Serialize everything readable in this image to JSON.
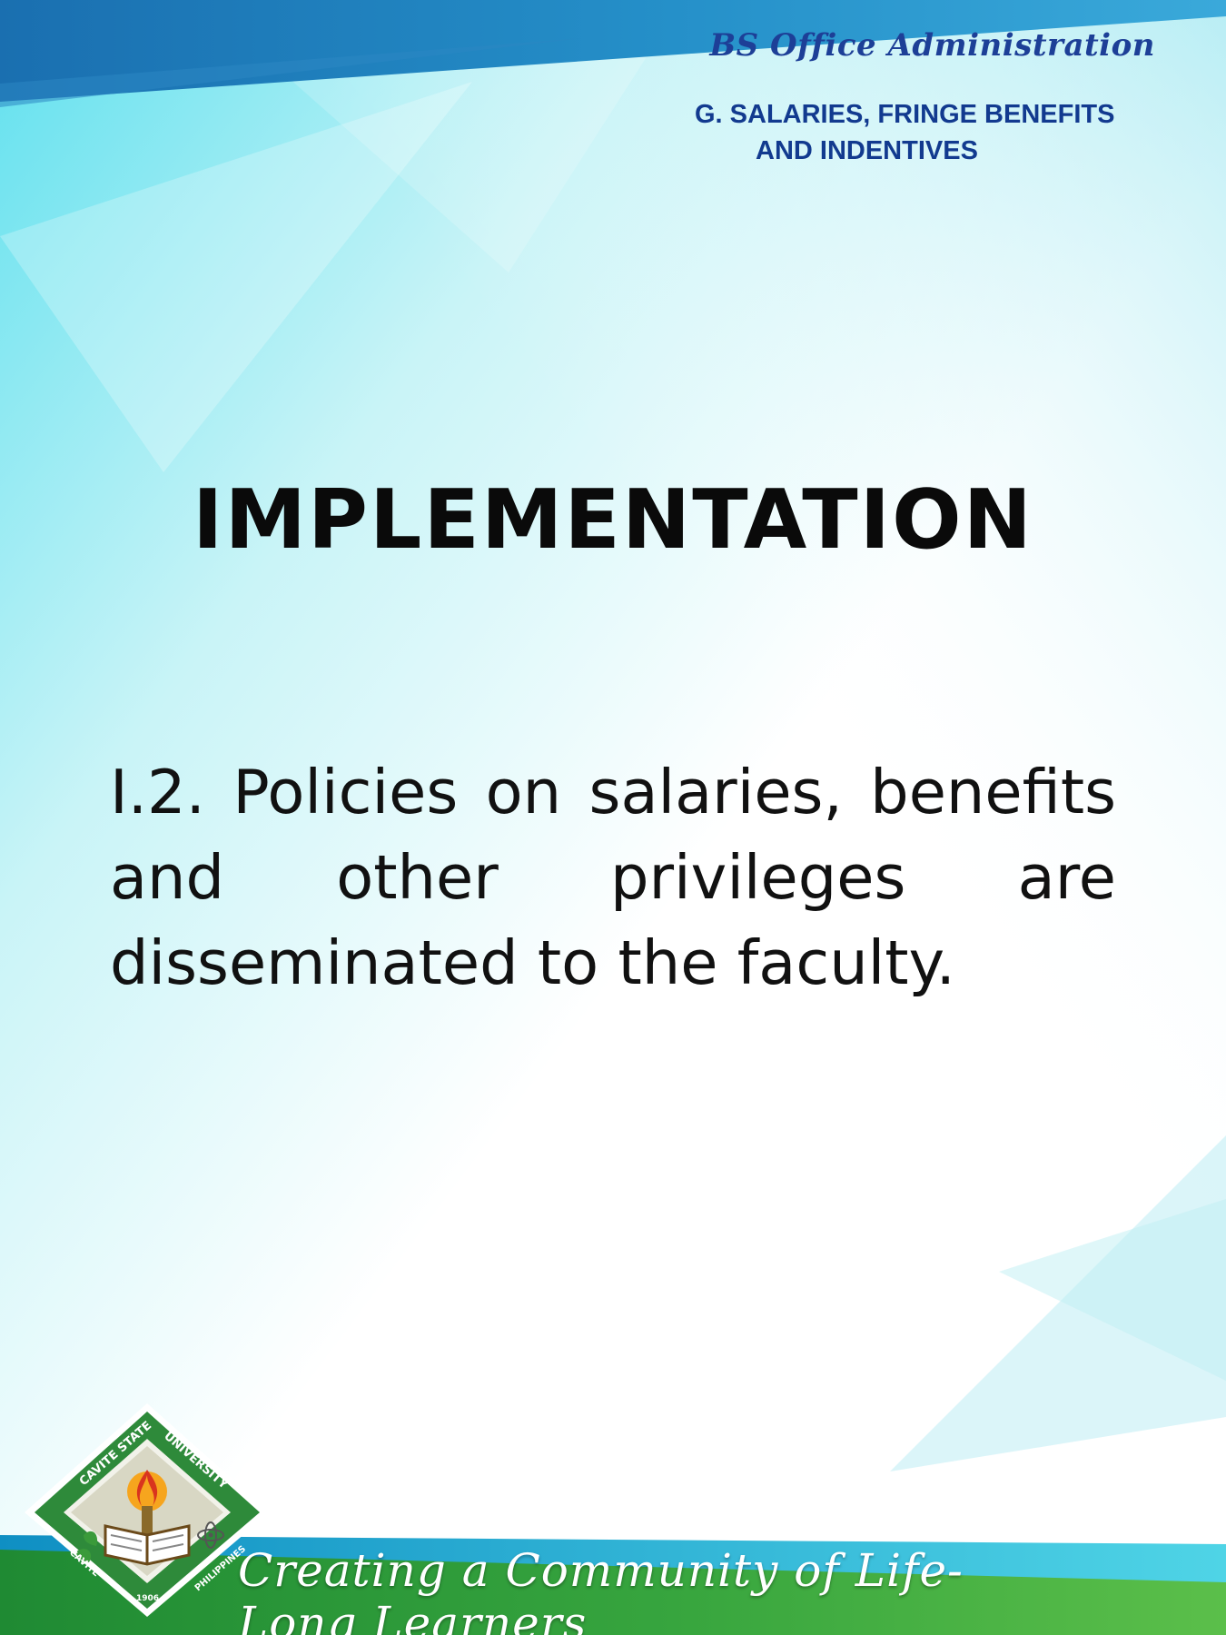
{
  "header": {
    "program_name": "BS Office Administration",
    "section_line1": "G. SALARIES, FRINGE BENEFITS",
    "section_line2": "AND INDENTIVES"
  },
  "main": {
    "title": "IMPLEMENTATION",
    "body": "I.2. Policies on salaries, benefits and other privileges are disseminated to the faculty."
  },
  "footer": {
    "tagline": "Creating a Community of Life-Long Learners",
    "logo_top_text": "CAVITE STATE UNIVERSITY",
    "logo_bottom_left": "CAVITE",
    "logo_bottom_right": "PHILIPPINES",
    "logo_year": "1906"
  },
  "colors": {
    "top_band": "#1a6fb0",
    "top_band_light": "#35a7d6",
    "header_text": "#1d3f97",
    "footer_green": "#2e9b3c",
    "footer_teal": "#17a9cf"
  }
}
